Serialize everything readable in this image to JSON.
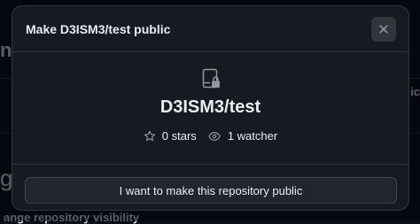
{
  "modal": {
    "title": "Make D3ISM3/test public",
    "close_icon": "x-icon",
    "repo_icon": "repo-locked-icon",
    "repo_name": "D3ISM3/test",
    "stats": {
      "stars_icon": "star-icon",
      "stars_label": "0 stars",
      "watchers_icon": "eye-icon",
      "watchers_label": "1 watcher"
    },
    "confirm_label": "I want to make this repository public"
  },
  "background": {
    "heading_fragment": "ne",
    "letter_fragment": "g",
    "right_fragment": "ic",
    "footer_fragment": "ange repository visibility"
  },
  "colors": {
    "page_bg": "#0d1117",
    "modal_bg": "#161b22",
    "border": "#30363d",
    "text": "#e6edf3",
    "muted_icon": "#9198a1"
  }
}
